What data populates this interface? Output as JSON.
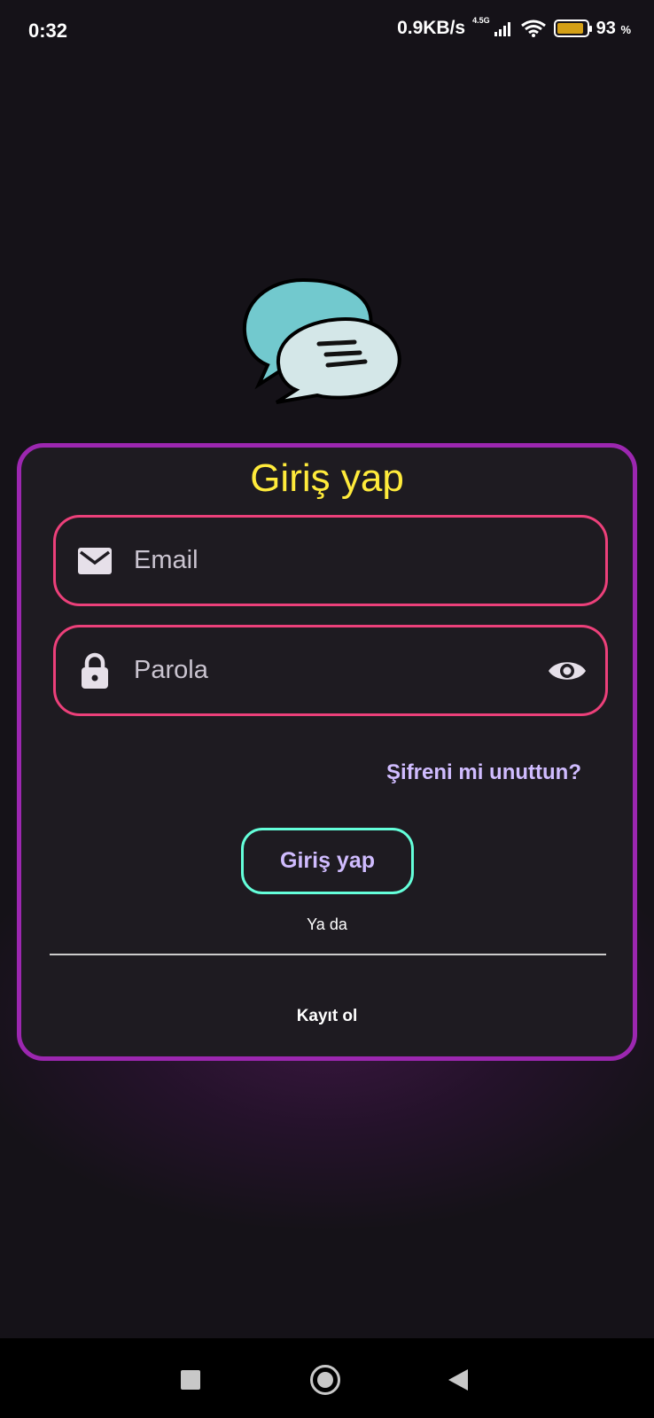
{
  "status_bar": {
    "time": "0:32",
    "net_speed": "0.9KB/s",
    "network_type": "4.5G",
    "battery_percent": "93",
    "battery_unit": "%",
    "battery_level": 0.93
  },
  "login_card": {
    "title": "Giriş yap",
    "email_placeholder": "Email",
    "password_placeholder": "Parola",
    "forgot_password": "Şifreni mi unuttun?",
    "login_button": "Giriş yap",
    "or_text": "Ya da",
    "register_link": "Kayıt ol"
  },
  "colors": {
    "background": "#151218",
    "card_border": "#9c27b0",
    "title": "#ffeb3b",
    "field_border": "#ec407a",
    "link": "#d0bcff",
    "button_border": "#64ffda"
  },
  "icons": {
    "email_field": "mail-icon",
    "password_field": "lock-icon",
    "password_toggle": "eye-icon",
    "app_logo": "chat-bubbles-logo"
  }
}
